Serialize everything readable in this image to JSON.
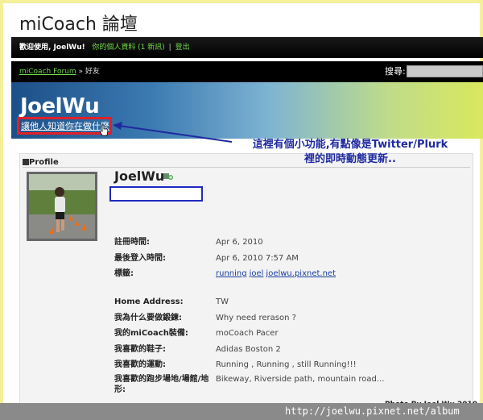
{
  "site": {
    "title": "miCoach 論壇"
  },
  "userbar": {
    "welcome": "歡迎使用, JoelWu!",
    "profile_link": "你的個人資料 (1 新訊)",
    "separator": "|",
    "logout": "登出"
  },
  "nav": {
    "breadcrumb_root": "miCoach Forum",
    "breadcrumb_sep": "»",
    "breadcrumb_current": "好友",
    "search_label": "搜尋:"
  },
  "banner": {
    "username": "JoelWu",
    "status_link": "讓他人知道你在做什麼"
  },
  "callout": {
    "line1": "這裡有個小功能,有點像是Twitter/Plurk",
    "line2": "裡的即時動態更新.."
  },
  "profile": {
    "section_title": "Profile",
    "name": "JoelWu",
    "rows": [
      {
        "label": "註冊時間:",
        "value": "Apr 6, 2010"
      },
      {
        "label": "最後登入時間:",
        "value": "Apr 6, 2010 7:57 AM"
      },
      {
        "label": "標籤:",
        "tags": [
          "running",
          "joel",
          "joelwu.pixnet.net"
        ]
      },
      {
        "label": "Home Address:",
        "value": "TW"
      },
      {
        "label": "我為什么要做鍛鍊:",
        "value": "Why need rerason ?"
      },
      {
        "label": "我的miCoach裝備:",
        "value": "moCoach Pacer"
      },
      {
        "label": "我喜歡的鞋子:",
        "value": "Adidas Boston 2"
      },
      {
        "label": "我喜歡的運動:",
        "value": "Running , Running , still Running!!!"
      },
      {
        "label": "我喜歡的跑步場地/場館/地形:",
        "value": "Bikeway, Riverside path, mountain road..."
      }
    ]
  },
  "watermark": {
    "credit": "Photo By Joel Wu 2010",
    "url": "http://joelwu.pixnet.net/album"
  },
  "colors": {
    "accent_green": "#6fd648",
    "highlight_red": "#e0202a",
    "callout_blue": "#1f2a9e"
  }
}
